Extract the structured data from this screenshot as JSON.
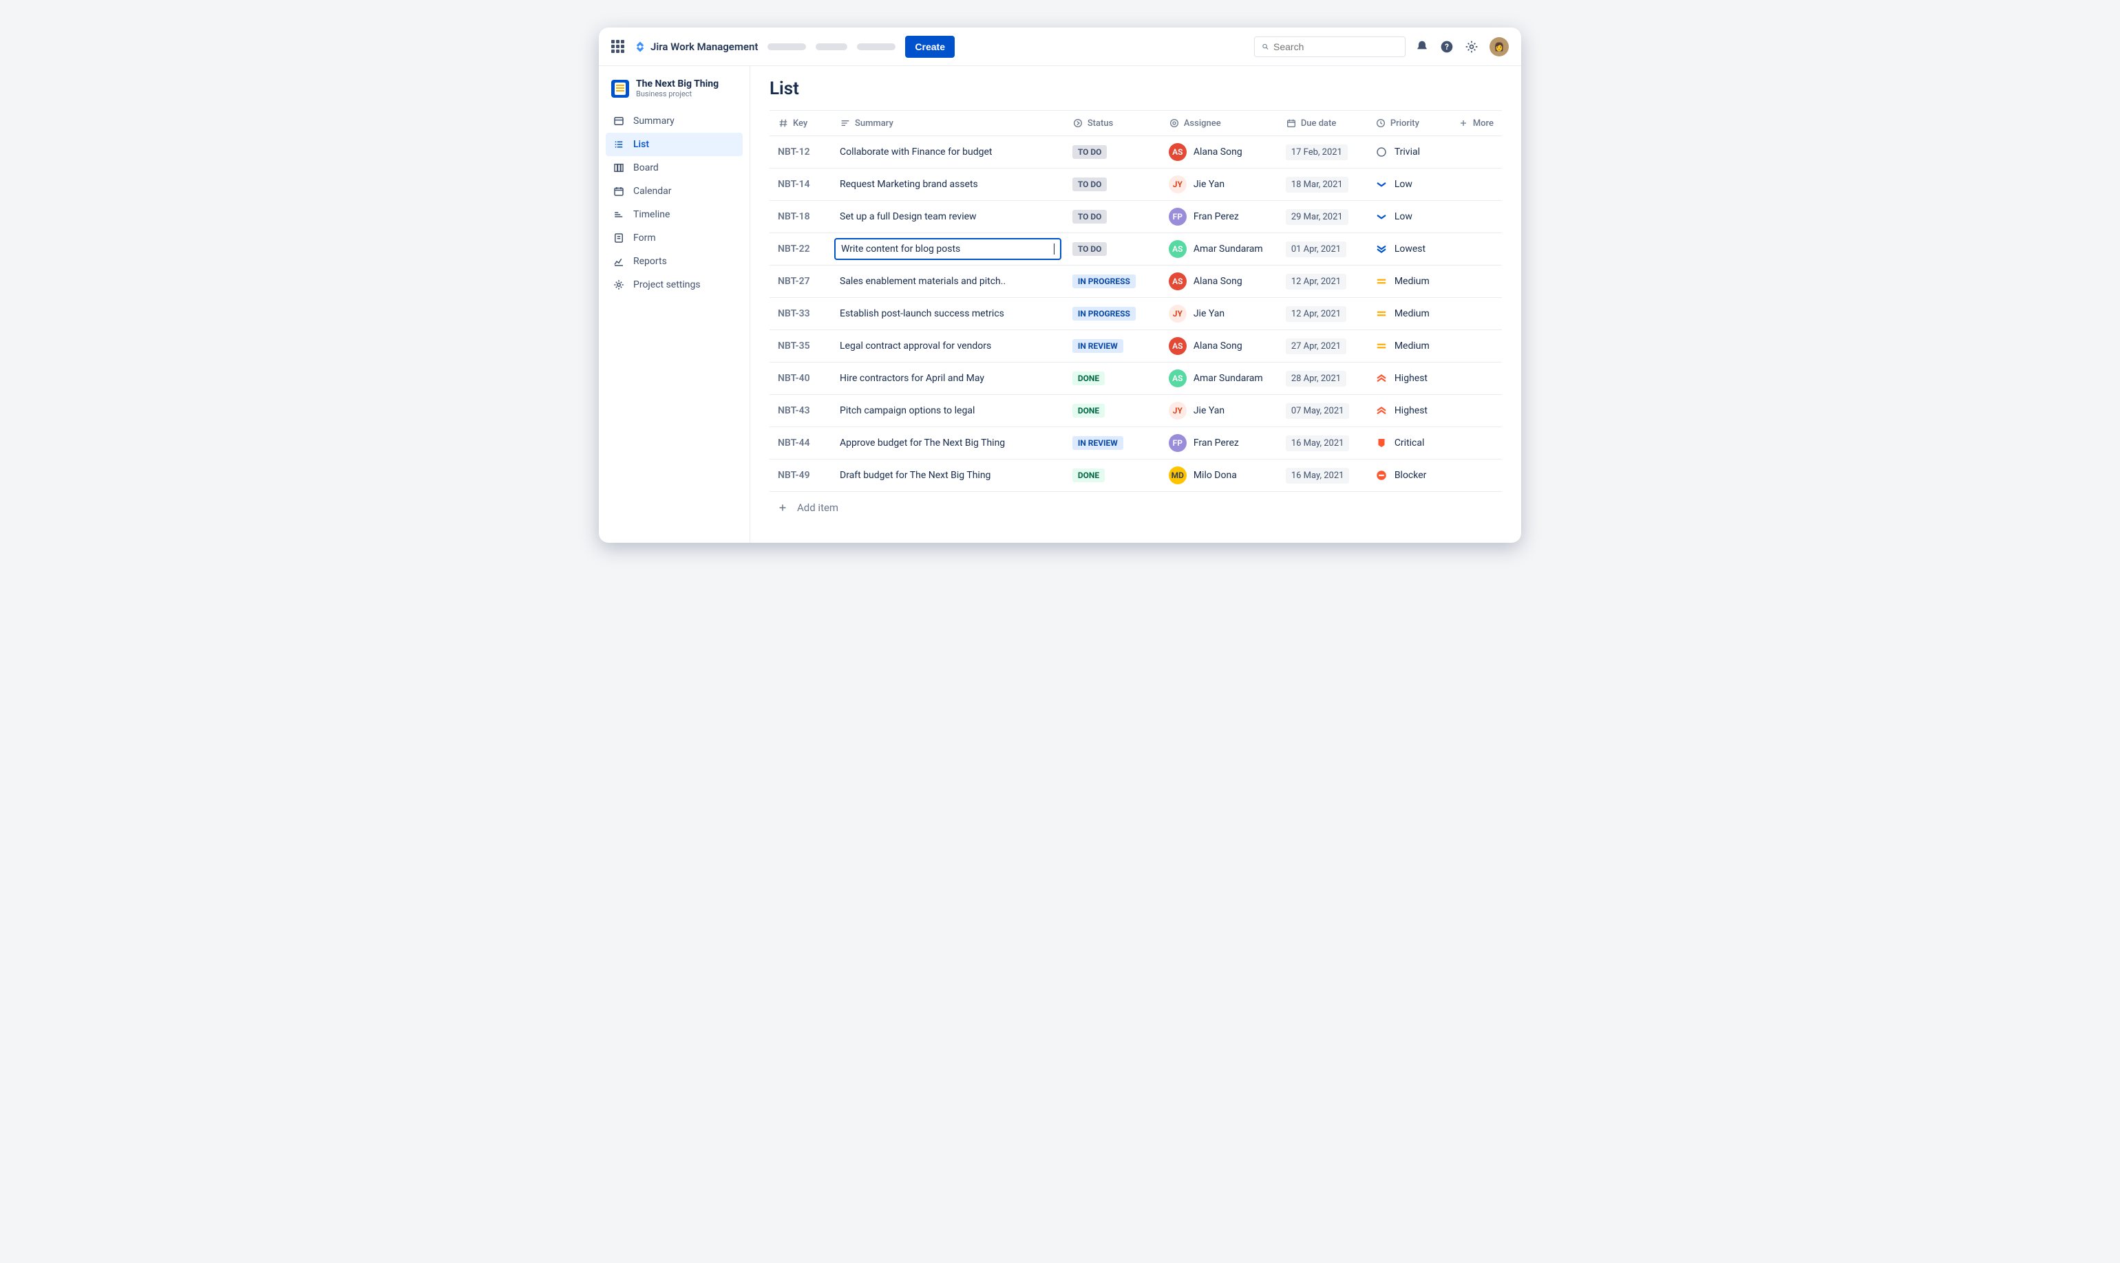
{
  "header": {
    "product_name": "Jira Work Management",
    "create_label": "Create",
    "search_placeholder": "Search"
  },
  "project": {
    "name": "The Next Big Thing",
    "subtitle": "Business project"
  },
  "sidebar": {
    "items": [
      {
        "label": "Summary"
      },
      {
        "label": "List"
      },
      {
        "label": "Board"
      },
      {
        "label": "Calendar"
      },
      {
        "label": "Timeline"
      },
      {
        "label": "Form"
      },
      {
        "label": "Reports"
      },
      {
        "label": "Project settings"
      }
    ],
    "active_index": 1
  },
  "page": {
    "title": "List",
    "add_item_label": "Add item"
  },
  "columns": {
    "key": "Key",
    "summary": "Summary",
    "status": "Status",
    "assignee": "Assignee",
    "due": "Due date",
    "priority": "Priority",
    "more": "More"
  },
  "status_labels": {
    "todo": "TO DO",
    "inprogress": "IN PROGRESS",
    "inreview": "IN REVIEW",
    "done": "DONE"
  },
  "priority_labels": {
    "trivial": "Trivial",
    "low": "Low",
    "lowest": "Lowest",
    "medium": "Medium",
    "highest": "Highest",
    "critical": "Critical",
    "blocker": "Blocker"
  },
  "assignee_avatars": {
    "Alana Song": "av-a",
    "Jie Yan": "av-b",
    "Fran Perez": "av-c",
    "Amar Sundaram": "av-d",
    "Milo Dona": "av-e"
  },
  "rows": [
    {
      "key": "NBT-12",
      "summary": "Collaborate with Finance for budget",
      "status": "todo",
      "assignee": "Alana Song",
      "due": "17 Feb, 2021",
      "priority": "trivial"
    },
    {
      "key": "NBT-14",
      "summary": "Request Marketing brand assets",
      "status": "todo",
      "assignee": "Jie Yan",
      "due": "18 Mar, 2021",
      "priority": "low"
    },
    {
      "key": "NBT-18",
      "summary": "Set up a full Design team review",
      "status": "todo",
      "assignee": "Fran Perez",
      "due": "29 Mar, 2021",
      "priority": "low"
    },
    {
      "key": "NBT-22",
      "summary": "Write content for blog posts",
      "status": "todo",
      "assignee": "Amar Sundaram",
      "due": "01 Apr, 2021",
      "priority": "lowest",
      "editing": true
    },
    {
      "key": "NBT-27",
      "summary": "Sales enablement materials and pitch..",
      "status": "inprogress",
      "assignee": "Alana Song",
      "due": "12 Apr, 2021",
      "priority": "medium"
    },
    {
      "key": "NBT-33",
      "summary": "Establish post-launch success metrics",
      "status": "inprogress",
      "assignee": "Jie Yan",
      "due": "12 Apr, 2021",
      "priority": "medium"
    },
    {
      "key": "NBT-35",
      "summary": "Legal contract approval for vendors",
      "status": "inreview",
      "assignee": "Alana Song",
      "due": "27 Apr, 2021",
      "priority": "medium"
    },
    {
      "key": "NBT-40",
      "summary": "Hire contractors for April and May",
      "status": "done",
      "assignee": "Amar Sundaram",
      "due": "28 Apr, 2021",
      "priority": "highest"
    },
    {
      "key": "NBT-43",
      "summary": "Pitch campaign options to legal",
      "status": "done",
      "assignee": "Jie Yan",
      "due": "07 May, 2021",
      "priority": "highest"
    },
    {
      "key": "NBT-44",
      "summary": "Approve budget for The Next Big Thing",
      "status": "inreview",
      "assignee": "Fran Perez",
      "due": "16 May, 2021",
      "priority": "critical"
    },
    {
      "key": "NBT-49",
      "summary": "Draft budget for The Next Big Thing",
      "status": "done",
      "assignee": "Milo Dona",
      "due": "16 May, 2021",
      "priority": "blocker"
    }
  ]
}
